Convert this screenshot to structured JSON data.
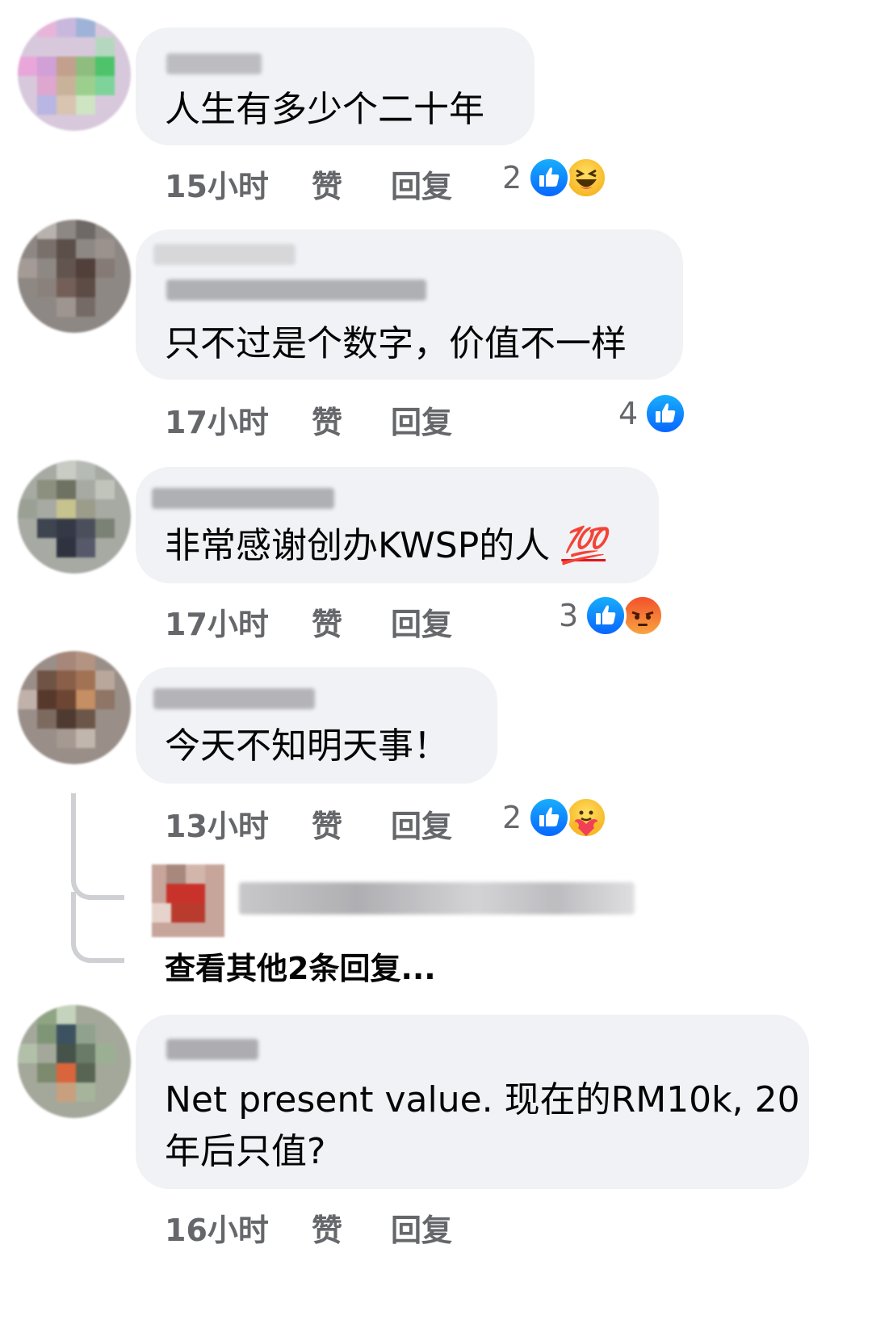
{
  "comments": [
    {
      "text": "人生有多少个二十年",
      "time": "15小时",
      "like": "赞",
      "reply": "回复",
      "reaction_count": "2",
      "reactions": [
        "like-icon",
        "haha-icon"
      ]
    },
    {
      "text": "只不过是个数字，价值不一样",
      "time": "17小时",
      "like": "赞",
      "reply": "回复",
      "reaction_count": "4",
      "reactions": [
        "like-icon"
      ]
    },
    {
      "text": "非常感谢创办KWSP的人",
      "emoji": "💯",
      "time": "17小时",
      "like": "赞",
      "reply": "回复",
      "reaction_count": "3",
      "reactions": [
        "like-icon",
        "angry-icon"
      ]
    },
    {
      "text": "今天不知明天事！",
      "time": "13小时",
      "like": "赞",
      "reply": "回复",
      "reaction_count": "2",
      "reactions": [
        "like-icon",
        "care-icon"
      ]
    },
    {
      "text_line1": "Net present value. 现在的RM10k, 20",
      "text_line2": "年后只值?",
      "time": "16小时",
      "like": "赞",
      "reply": "回复"
    }
  ],
  "thread": {
    "view_more": "查看其他2条回复..."
  },
  "colors": {
    "bubble": "#f0f2f5",
    "meta_text": "#65676b",
    "like_blue": "#0866ff",
    "thread_line": "#ced0d4"
  }
}
